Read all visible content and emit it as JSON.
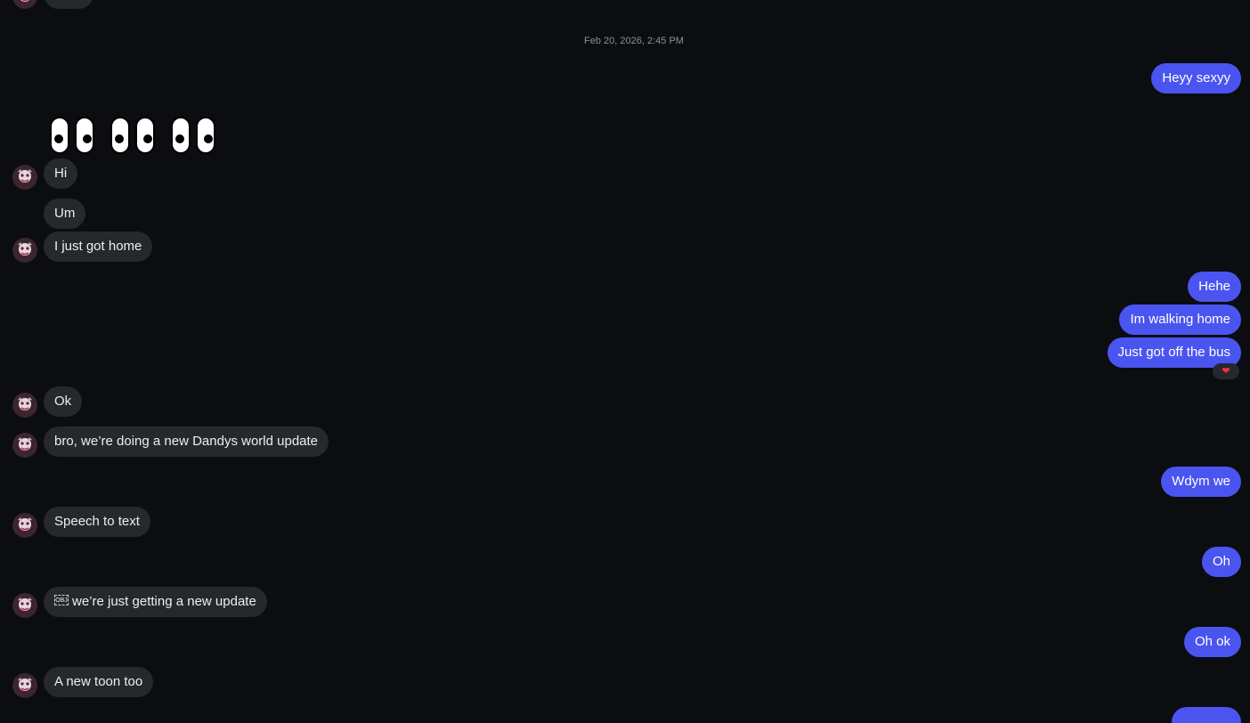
{
  "timestamp": "Feb 20, 2026, 2:45 PM",
  "messages": {
    "m1": "Heyy sexyy",
    "m2": "Hi",
    "m3": "Um",
    "m4": "I just got home",
    "m5": "Hehe",
    "m6": "Im walking home",
    "m7": "Just got off the bus",
    "m8": "Ok",
    "m9": "bro, we’re doing a new Dandys world update",
    "m10": "Wdym we",
    "m11": "Speech to text",
    "m12": "Oh",
    "m13_emoji": "OBJ",
    "m13": "we’re just getting a new update",
    "m14": "Oh ok",
    "m15": "A new toon too"
  },
  "reaction": "❤",
  "emoji_message": "eyes-emoji-x3",
  "colors": {
    "background": "#0b0d11",
    "incoming_bubble": "#26282d",
    "outgoing_bubble": "#4a55f0",
    "timestamp_text": "#8d9199"
  }
}
